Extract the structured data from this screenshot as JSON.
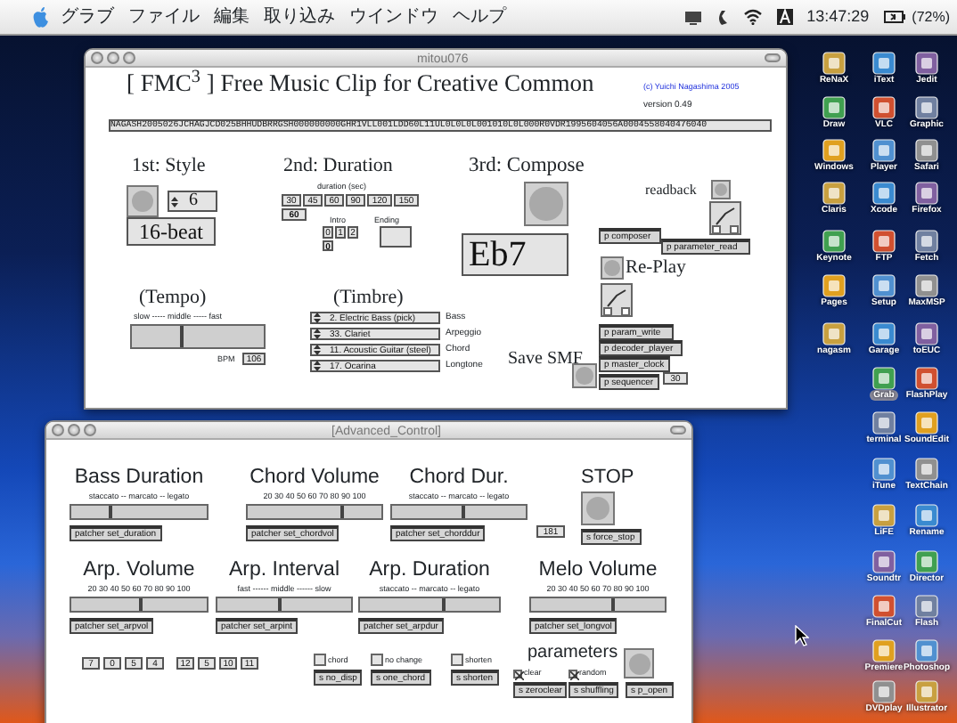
{
  "menubar": {
    "menus": [
      "グラブ",
      "ファイル",
      "編集",
      "取り込み",
      "ウインドウ",
      "ヘルプ"
    ],
    "clock": "13:47:29",
    "battery": "(72%)"
  },
  "main_window": {
    "title": "mitou076",
    "heading": "[ FMC$^{3}$ ] Free Music Clip for Creative Common",
    "credit": "(c) Yuichi Nagashima 2005",
    "version": "version 0.49",
    "code": "NAGASH2005026JCHAGJCD025BHHUDBRRGSH000000000GHR1VLL001LDD60L11UL0L0L0L001010L0L000R0VDR1995604056A0004558040476040",
    "style": {
      "title": "1st: Style",
      "number": "6",
      "pattern": "16-beat"
    },
    "duration": {
      "title": "2nd: Duration",
      "caption": "duration (sec)",
      "options": [
        "30",
        "45",
        "60",
        "90",
        "120",
        "150"
      ],
      "value": "60",
      "intro_label": "Intro",
      "intro_options": [
        "0",
        "1",
        "2"
      ],
      "intro_value": "0",
      "ending_label": "Ending"
    },
    "compose": {
      "title": "3rd: Compose",
      "chord": "Eb7",
      "readback_label": "readback",
      "replay_label": "Re-Play",
      "save_label": "Save SMF",
      "clock_value": "30"
    },
    "objects": [
      "p composer",
      "p parameter_read",
      "p param_write",
      "p decoder_player",
      "p master_clock",
      "p sequencer"
    ],
    "tempo": {
      "title": "(Tempo)",
      "scale": "slow ----- middle ----- fast",
      "level": 0.37,
      "bpm_label": "BPM",
      "bpm": "106"
    },
    "timbre": {
      "title": "(Timbre)",
      "rows": [
        {
          "instrument": "2. Electric Bass (pick)",
          "part": "Bass"
        },
        {
          "instrument": "33. Clariet",
          "part": "Arpeggio"
        },
        {
          "instrument": "11. Acoustic Guitar (steel)",
          "part": "Chord"
        },
        {
          "instrument": "17. Ocarina",
          "part": "Longtone"
        }
      ]
    }
  },
  "advanced_window": {
    "title": "[Advanced_Control]",
    "sliders": [
      {
        "title": "Bass Duration",
        "scale": "staccato -- marcato -- legato",
        "level": 0.28,
        "object": "patcher set_duration"
      },
      {
        "title": "Chord Volume",
        "scale": "20 30 40 50 60 70 80 90 100",
        "level": 0.71,
        "object": "patcher set_chordvol"
      },
      {
        "title": "Chord Dur.",
        "scale": "staccato -- marcato -- legato",
        "level": 0.53,
        "object": "patcher set_chorddur"
      },
      {
        "title": "Arp. Volume",
        "scale": "20 30 40 50 60 70 80 90 100",
        "level": 0.52,
        "object": "patcher set_arpvol"
      },
      {
        "title": "Arp. Interval",
        "scale": "fast ------ middle ------ slow",
        "level": 0.46,
        "object": "patcher set_arpint"
      },
      {
        "title": "Arp. Duration",
        "scale": "staccato -- marcato -- legato",
        "level": 0.6,
        "object": "patcher set_arpdur"
      },
      {
        "title": "Melo Volume",
        "scale": "20 30 40 50 60 70 80 90 100",
        "level": 0.62,
        "object": "patcher set_longvol"
      }
    ],
    "chord_dur_number": "181",
    "stop": {
      "title": "STOP",
      "object": "s force_stop"
    },
    "number_boxes": [
      "7",
      "0",
      "5",
      "4",
      "12",
      "5",
      "10",
      "11"
    ],
    "toggles": [
      {
        "label": "chord",
        "checked": false,
        "object": "s no_disp"
      },
      {
        "label": "no change",
        "checked": false,
        "object": "s one_chord"
      },
      {
        "label": "shorten",
        "checked": false,
        "object": "s shorten"
      }
    ],
    "parameters": {
      "title": "parameters",
      "toggles": [
        {
          "label": "clear",
          "checked": true,
          "object": "s zeroclear"
        },
        {
          "label": "random",
          "checked": true,
          "object": "s shuffling"
        }
      ],
      "open_object": "s p_open"
    }
  },
  "desktop_icons": [
    {
      "label": "ReNaX",
      "selected": false
    },
    {
      "label": "iText",
      "selected": false
    },
    {
      "label": "Jedit",
      "selected": false
    },
    {
      "label": "Draw",
      "selected": false
    },
    {
      "label": "VLC",
      "selected": false
    },
    {
      "label": "Graphic",
      "selected": false
    },
    {
      "label": "Windows",
      "selected": false
    },
    {
      "label": "Player",
      "selected": false
    },
    {
      "label": "Safari",
      "selected": false
    },
    {
      "label": "Claris",
      "selected": false
    },
    {
      "label": "Xcode",
      "selected": false
    },
    {
      "label": "Firefox",
      "selected": false
    },
    {
      "label": "Keynote",
      "selected": false
    },
    {
      "label": "FTP",
      "selected": false
    },
    {
      "label": "Fetch",
      "selected": false
    },
    {
      "label": "Pages",
      "selected": false
    },
    {
      "label": "Setup",
      "selected": false
    },
    {
      "label": "MaxMSP",
      "selected": false
    },
    {
      "label": "nagasm",
      "selected": false
    },
    {
      "label": "Garage",
      "selected": false
    },
    {
      "label": "toEUC",
      "selected": false
    },
    {
      "label": "Grab",
      "selected": true
    },
    {
      "label": "FlashPlay",
      "selected": false
    },
    {
      "label": "terminal",
      "selected": false
    },
    {
      "label": "SoundEdit",
      "selected": false
    },
    {
      "label": "iTune",
      "selected": false
    },
    {
      "label": "TextChain",
      "selected": false
    },
    {
      "label": "LiFE",
      "selected": false
    },
    {
      "label": "Rename",
      "selected": false
    },
    {
      "label": "Soundtr",
      "selected": false
    },
    {
      "label": "Director",
      "selected": false
    },
    {
      "label": "FinalCut",
      "selected": false
    },
    {
      "label": "Flash",
      "selected": false
    },
    {
      "label": "Premiere",
      "selected": false
    },
    {
      "label": "Photoshop",
      "selected": false
    },
    {
      "label": "DVDplay",
      "selected": false
    },
    {
      "label": "Illustrator",
      "selected": false
    }
  ]
}
